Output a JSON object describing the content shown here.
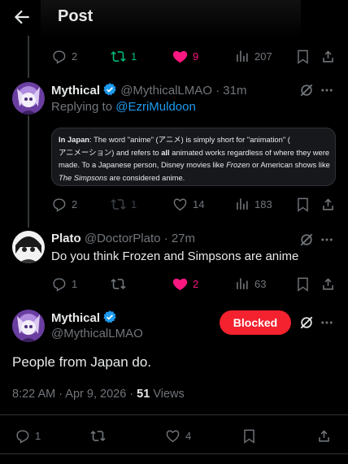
{
  "header": {
    "title": "Post"
  },
  "top_actions": {
    "replies": "2",
    "reposts": "1",
    "likes": "9",
    "views": "207"
  },
  "reply1": {
    "display_name": "Mythical",
    "handle": "@MythicalLMAO",
    "sep": "·",
    "time": "31m",
    "replying_prefix": "Replying to",
    "replying_to": "@EzriMuldoon",
    "quote": {
      "p1_bold": "In Japan",
      "p1_a": ": The word \"anime\" (アニメ) is simply short for \"animation\" (",
      "p1_b": "アニメーション) and refers to ",
      "p1_all": "all",
      "p1_c": " animated works regardless of where they were",
      "p1_d": "made. To a Japanese person, Disney movies like ",
      "p1_frozen": "Frozen",
      "p1_e": " or American shows like",
      "p1_simpsons": "The Simpsons",
      "p1_f": " are considered anime."
    },
    "actions": {
      "replies": "2",
      "reposts": "1",
      "likes": "14",
      "views": "183"
    }
  },
  "reply2": {
    "display_name": "Plato",
    "handle": "@DoctorPlato",
    "sep": "·",
    "time": "27m",
    "text": "Do you think Frozen and Simpsons are anime",
    "actions": {
      "replies": "1",
      "reposts": "",
      "likes": "2",
      "views": "63"
    }
  },
  "main": {
    "display_name": "Mythical",
    "handle": "@MythicalLMAO",
    "blocked_label": "Blocked",
    "text": "People from Japan do.",
    "timestamp": "8:22 AM · Apr 9, 2026 · ",
    "views_count": "51",
    "views_label": " Views",
    "actions": {
      "replies": "1",
      "likes": "4"
    }
  },
  "colors": {
    "accent": "#1d9bf0",
    "like": "#f91880",
    "repost": "#00ba7c",
    "blocked": "#f4212e",
    "verified": "#1d9bf0"
  },
  "icons": [
    "back-arrow-icon",
    "reply-icon",
    "repost-icon",
    "heart-icon",
    "views-icon",
    "bookmark-icon",
    "share-icon",
    "more-icon",
    "grok-icon",
    "verified-badge-icon"
  ]
}
